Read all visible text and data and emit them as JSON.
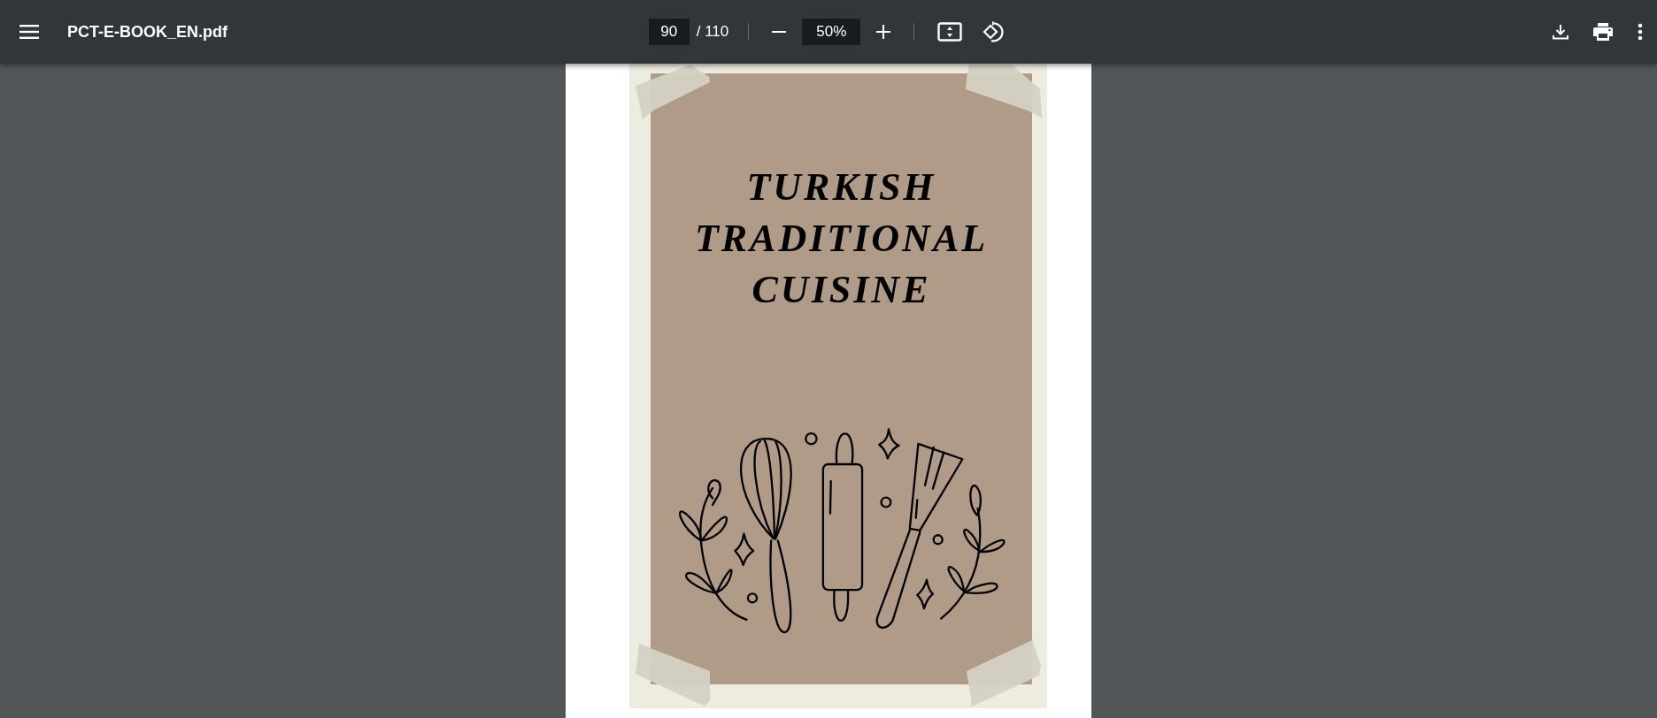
{
  "toolbar": {
    "file_name": "PCT-E-BOOK_EN.pdf",
    "page_number": "90",
    "page_total": "/ 110",
    "zoom": "50%"
  },
  "document": {
    "title_lines": [
      "TURKISH",
      "TRADITIONAL",
      "CUISINE"
    ]
  }
}
